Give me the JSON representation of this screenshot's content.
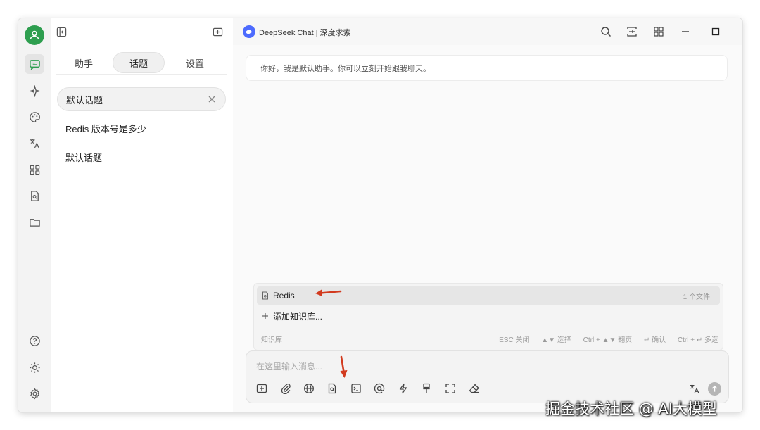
{
  "rail": {
    "items": [
      "chat",
      "sparkle",
      "palette",
      "translate",
      "apps",
      "knowledge",
      "folder"
    ],
    "bottom": [
      "help",
      "theme",
      "settings"
    ]
  },
  "panel": {
    "tabs": [
      "助手",
      "话题",
      "设置"
    ],
    "active_tab": "话题",
    "topics": [
      {
        "label": "默认话题",
        "active": true
      },
      {
        "label": "Redis 版本号是多少",
        "active": false
      },
      {
        "label": "默认话题",
        "active": false
      }
    ]
  },
  "titlebar": {
    "app_title": "DeepSeek Chat | 深度求索"
  },
  "chat": {
    "welcome": "你好，我是默认助手。你可以立刻开始跟我聊天。"
  },
  "knowledge_popup": {
    "item_label": "Redis",
    "item_count": "1 个文件",
    "add_label": "添加知识库...",
    "footer_left": "知识库",
    "hint_esc": "ESC 关闭",
    "hint_select": "▲▼ 选择",
    "hint_page": "Ctrl + ▲▼ 翻页",
    "hint_confirm": "↵ 确认",
    "hint_multi": "Ctrl + ↵ 多选"
  },
  "input": {
    "placeholder": "在这里输入消息..."
  },
  "watermark": "掘金技术社区 @ AI大模型",
  "colors": {
    "accent_green": "#2e9e4f",
    "deepseek_blue": "#4d6bfe",
    "annotation_red": "#d23a1e"
  }
}
